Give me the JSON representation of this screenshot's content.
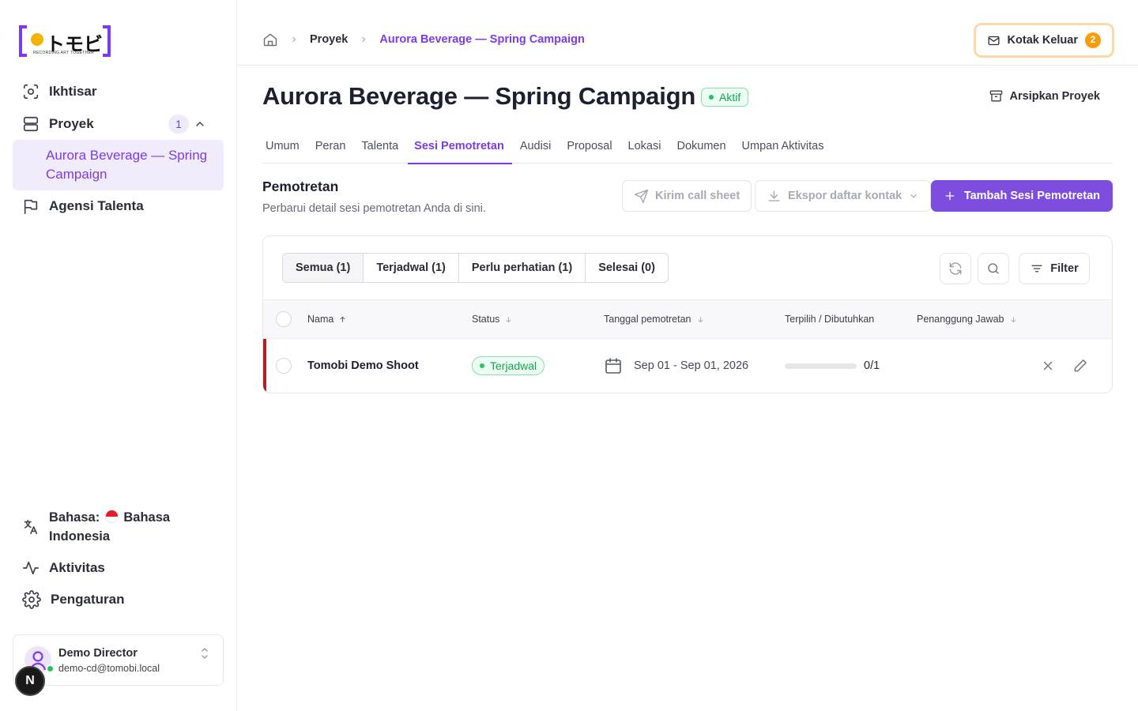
{
  "brand": {
    "name": "トモビ",
    "tagline": "RECORDING ART TOGETHER",
    "accent": "#7c3aed",
    "dot_color": "#f5b301"
  },
  "sidebar": {
    "overview": "Ikhtisar",
    "projects": {
      "label": "Proyek",
      "count": "1"
    },
    "active_project": "Aurora Beverage — Spring Campaign",
    "agencies": "Agensi Talenta",
    "language_label": "Bahasa:",
    "language_value": "Bahasa Indonesia",
    "activity": "Aktivitas",
    "settings": "Pengaturan",
    "user": {
      "name": "Demo Director",
      "email": "demo-cd@tomobi.local"
    },
    "dev_badge": "N"
  },
  "topbar": {
    "breadcrumbs": {
      "home_icon": "home-icon",
      "projects": "Proyek",
      "current": "Aurora Beverage — Spring Campaign"
    },
    "inbox": {
      "label": "Kotak Keluar",
      "count": "2"
    }
  },
  "project": {
    "title": "Aurora Beverage — Spring Campaign",
    "status": "Aktif",
    "archive_label": "Arsipkan Proyek"
  },
  "tabs": [
    "Umum",
    "Peran",
    "Talenta",
    "Sesi Pemotretan",
    "Audisi",
    "Proposal",
    "Lokasi",
    "Dokumen",
    "Umpan Aktivitas"
  ],
  "active_tab": "Sesi Pemotretan",
  "section": {
    "title": "Pemotretan",
    "subtitle": "Perbarui detail sesi pemotretan Anda di sini.",
    "send_call_sheet": "Kirim call sheet",
    "export_contacts": "Ekspor daftar kontak",
    "add_session": "Tambah Sesi Pemotretan"
  },
  "filters": {
    "segments": [
      "Semua (1)",
      "Terjadwal (1)",
      "Perlu perhatian (1)",
      "Selesai (0)"
    ],
    "active_segment": "Semua (1)",
    "filter_label": "Filter"
  },
  "table": {
    "columns": {
      "name": "Nama",
      "status": "Status",
      "date": "Tanggal pemotretan",
      "selected": "Terpilih / Dibutuhkan",
      "owner": "Penanggung Jawab"
    },
    "rows": [
      {
        "name": "Tomobi Demo Shoot",
        "status": "Terjadwal",
        "date": "Sep 01 - Sep 01, 2026",
        "selected_fraction": 0,
        "selected_text": "0/1",
        "owner": ""
      }
    ]
  }
}
